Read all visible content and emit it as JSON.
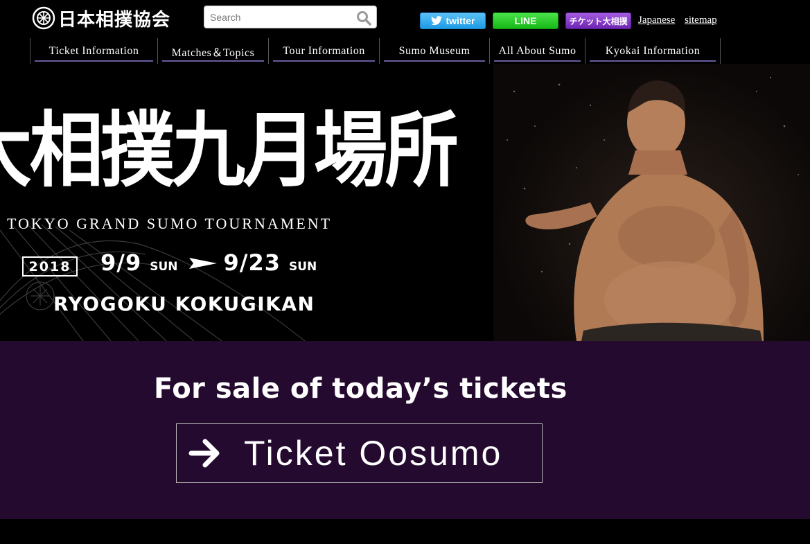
{
  "header": {
    "logo_text": "日本相撲協会",
    "search": {
      "placeholder": "Search"
    },
    "social": {
      "twitter_label": "twitter",
      "line_label": "LINE",
      "ticket_label": "チケット大相撲"
    },
    "links": {
      "japanese": "Japanese",
      "sitemap": "sitemap"
    }
  },
  "nav": {
    "items": [
      {
        "label": "Ticket Information"
      },
      {
        "label": "Matches＆Topics"
      },
      {
        "label": "Tour Information"
      },
      {
        "label": "Sumo Museum"
      },
      {
        "label": "All About Sumo"
      },
      {
        "label": "Kyokai Information"
      }
    ]
  },
  "hero": {
    "title_jp": "大相撲九月場所",
    "subtitle": "TOKYO GRAND SUMO TOURNAMENT",
    "year": "2018",
    "start_date": "9/9",
    "start_day": "SUN",
    "end_date": "9/23",
    "end_day": "SUN",
    "venue": "RYOGOKU KOKUGIKAN"
  },
  "ticket_section": {
    "heading": "For sale of today’s tickets",
    "button_label": "Ticket Oosumo"
  },
  "colors": {
    "page_bg": "#000000",
    "ticket_section_bg": "#250a2f",
    "nav_underline": "#6b5a9e",
    "twitter": "#1d9be6",
    "line": "#16b816",
    "ticket_oosumo": "#6e25b3"
  },
  "icons": {
    "logo": "crest-icon",
    "search": "search-icon",
    "twitter": "twitter-bird-icon",
    "dates_separator": "arrow-right-icon",
    "ticket_button": "arrow-right-icon"
  }
}
